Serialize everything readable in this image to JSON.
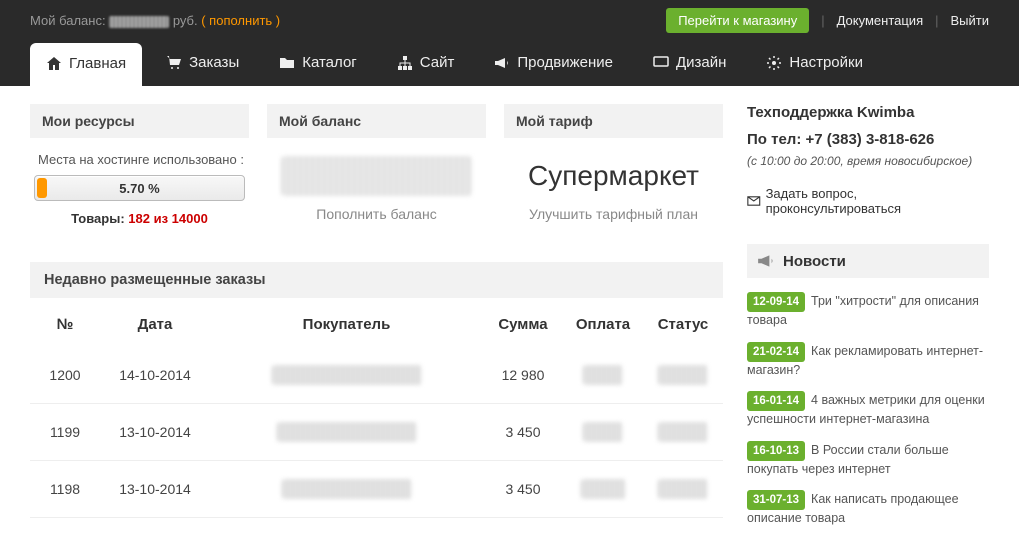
{
  "topbar": {
    "balance_label": "Мой баланс:",
    "balance_suffix": "руб.",
    "topup": "( пополнить )",
    "go_store": "Перейти к магазину",
    "docs": "Документация",
    "logout": "Выйти"
  },
  "nav": {
    "main": "Главная",
    "orders": "Заказы",
    "catalog": "Каталог",
    "site": "Сайт",
    "promo": "Продвижение",
    "design": "Дизайн",
    "settings": "Настройки"
  },
  "resources": {
    "title": "Мои ресурсы",
    "hosting_label": "Места на хостинге использовано :",
    "percent": "5.70 %",
    "goods_prefix": "Товары: ",
    "goods_value": "182 из 14000"
  },
  "balance": {
    "title": "Мой баланс",
    "action": "Пополнить баланс"
  },
  "tariff": {
    "title": "Мой тариф",
    "name": "Супермаркет",
    "action": "Улучшить тарифный план"
  },
  "recent_orders": {
    "title": "Недавно размещенные заказы",
    "cols": {
      "n": "№",
      "date": "Дата",
      "buyer": "Покупатель",
      "sum": "Сумма",
      "payment": "Оплата",
      "status": "Статус"
    },
    "rows": [
      {
        "n": "1200",
        "date": "14-10-2014",
        "sum": "12 980"
      },
      {
        "n": "1199",
        "date": "13-10-2014",
        "sum": "3 450"
      },
      {
        "n": "1198",
        "date": "13-10-2014",
        "sum": "3 450"
      }
    ]
  },
  "support": {
    "title": "Техподдержка Kwimba",
    "phone_label": "По тел: ",
    "phone": "+7 (383) 3-818-626",
    "hours": "(с 10:00 до 20:00, время новосибирское)",
    "ask": "Задать вопрос, проконсультироваться"
  },
  "news": {
    "title": "Новости",
    "items": [
      {
        "date": "12-09-14",
        "text": "Три \"хитрости\" для описания товара"
      },
      {
        "date": "21-02-14",
        "text": "Как рекламировать интернет-магазин?"
      },
      {
        "date": "16-01-14",
        "text": "4 важных метрики для оценки успешности интернет-магазина"
      },
      {
        "date": "16-10-13",
        "text": "В России стали больше покупать через интернет"
      },
      {
        "date": "31-07-13",
        "text": "Как написать продающее описание товара"
      }
    ]
  }
}
